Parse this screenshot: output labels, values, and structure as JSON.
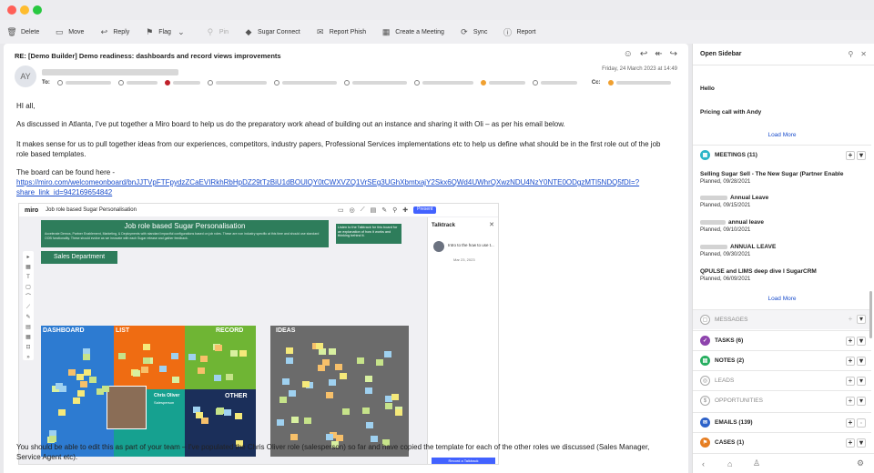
{
  "toolbar": {
    "items": [
      {
        "label": "Delete",
        "icon": "trash-icon"
      },
      {
        "label": "Move",
        "icon": "folder-icon"
      },
      {
        "label": "Reply",
        "icon": "reply-icon"
      },
      {
        "label": "Flag",
        "icon": "flag-icon"
      },
      {
        "label": "Pin",
        "icon": "pin-icon"
      },
      {
        "label": "Sugar Connect",
        "icon": "sugar-icon"
      },
      {
        "label": "Report Phish",
        "icon": "phish-icon"
      },
      {
        "label": "Create a Meeting",
        "icon": "meeting-icon"
      },
      {
        "label": "Sync",
        "icon": "sync-icon"
      },
      {
        "label": "Report",
        "icon": "report-icon"
      }
    ]
  },
  "email": {
    "subject": "RE: [Demo Builder] Demo readiness: dashboards and record views improvements",
    "avatar_initials": "AY",
    "date": "Friday, 24 March 2023 at 14:49",
    "to_label": "To:",
    "cc_label": "Cc:",
    "greeting": "HI all,",
    "para1": "As discussed in Atlanta, I've put together a Miro board to help us do the preparatory work ahead of building out an instance and sharing it with Oli – as per his email below.",
    "para2": "It makes sense for us to pull together ideas from our experiences, competitors, industry papers, Professional Services implementations etc to help us define what should be in the first role out of the job role based templates.",
    "para3": "The board can be found here -",
    "link_line1": "https://miro.com/welcomeonboard/bnJJTVpFTFpydzZCaEVIRkhRbHpDZ29tTzBiU1dBOUlQY0tCWXVZQ1VrSEg3UGhXbmtxajY2Skx6QWd4UWhrQXwzNDU4NzY0NTE0ODgzMTI5NDQ5fDI=?",
    "link_line2": "share_link_id=942169654842",
    "para4": "You should be able to edit this as part of your team – I've populated the Chris Oliver role (salesperson) so far and have copied the template for each of the other roles we discussed (Sales Manager, Service Agent etc)."
  },
  "miro": {
    "logo": "miro",
    "board_name": "Job role based Sugar Personalisation",
    "banner_title": "Job role based Sugar Personalisation",
    "banner_text": "Accelerate Demos, Partner Enablement, Marketing, & Deployments with standard impactful configurations based on job roles. These are non industry specific at this time and should use standard OOB functionality. These should evolve as we innovate with each Sugar release and gather feedback.",
    "callout": "Listen to the Talktrack for this board for an explanation of how it works and thinking behind it.",
    "sales_department": "Sales Department",
    "dashboard": "DASHBOARD",
    "list": "LIST",
    "record": "RECORD",
    "ideas": "IDEAS",
    "other": "OTHER",
    "person_name": "Chris Oliver",
    "person_role": "Salesperson",
    "talktrack": "Talktrack",
    "talk_intro": "Intro to the how to use t...",
    "talk_date": "Mar 23, 2023",
    "present_btn": "Present",
    "record_btn": "Record a Talktrack"
  },
  "sidebar": {
    "title": "Open Sidebar",
    "hello": "Hello",
    "pricing_call": "Pricing call with Andy",
    "load_more": "Load More",
    "meetings": {
      "label": "MEETINGS (11)",
      "items": [
        {
          "title": "Selling Sugar Sell - The New Sugar (Partner Enable",
          "date": "Planned, 09/28/2021"
        },
        {
          "title": "Annual Leave",
          "date": "Planned, 09/15/2021"
        },
        {
          "title": "annual leave",
          "date": "Planned, 09/10/2021"
        },
        {
          "title": "ANNUAL LEAVE",
          "date": "Planned, 09/30/2021"
        },
        {
          "title": "QPULSE and LIMS deep dive I SugarCRM",
          "date": "Planned, 06/09/2021"
        }
      ]
    },
    "sections": [
      {
        "label": "MESSAGES"
      },
      {
        "label": "TASKS (6)"
      },
      {
        "label": "NOTES (2)"
      },
      {
        "label": "LEADS"
      },
      {
        "label": "OPPORTUNITIES"
      },
      {
        "label": "EMAILS (139)"
      },
      {
        "label": "CASES (1)"
      }
    ]
  }
}
